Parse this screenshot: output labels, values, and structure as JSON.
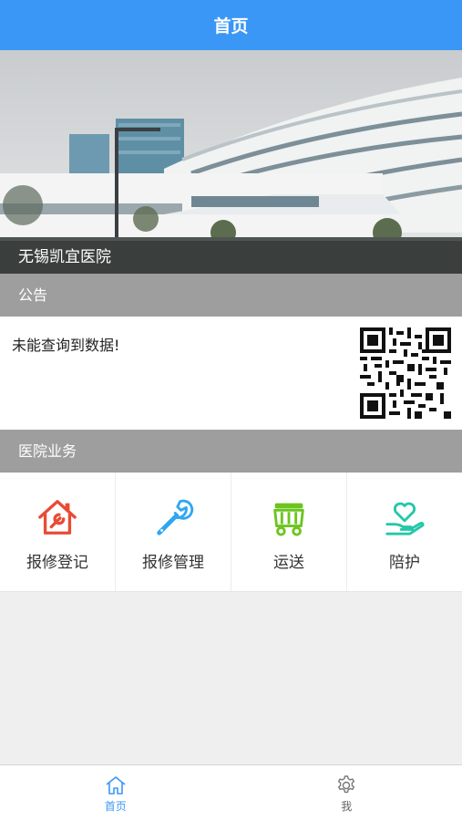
{
  "header": {
    "title": "首页"
  },
  "banner": {
    "caption": "无锡凯宜医院"
  },
  "notice": {
    "section_title": "公告",
    "message": "未能查询到数据!"
  },
  "services": {
    "section_title": "医院业务",
    "items": [
      {
        "label": "报修登记",
        "icon": "house-wrench-icon",
        "color": "#e94b35"
      },
      {
        "label": "报修管理",
        "icon": "wrench-icon",
        "color": "#2fa7f0"
      },
      {
        "label": "运送",
        "icon": "cart-icon",
        "color": "#6cc51f"
      },
      {
        "label": "陪护",
        "icon": "heart-hand-icon",
        "color": "#25c7a9"
      }
    ]
  },
  "tabbar": {
    "tabs": [
      {
        "label": "首页",
        "icon": "home-icon",
        "active": true
      },
      {
        "label": "我",
        "icon": "gear-icon",
        "active": false
      }
    ],
    "active_color": "#3a97f6"
  },
  "theme": {
    "primary": "#3a97f6",
    "section_bg": "#9e9e9e",
    "page_bg": "#efefef"
  }
}
